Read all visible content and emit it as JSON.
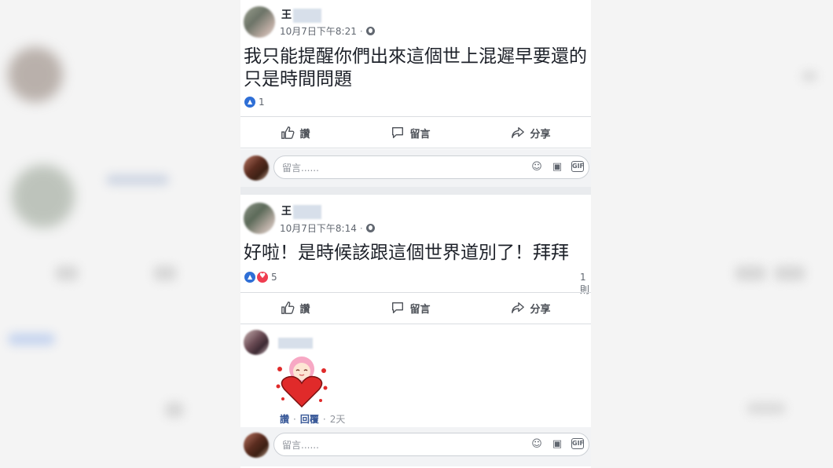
{
  "posts": [
    {
      "author": "王",
      "timestamp": "10月7日下午8:21",
      "text_line1": "我只能提醒你們出來這個世上混遲早要還的",
      "text_line2": "只是時間問題",
      "reaction_count": "1",
      "comment_count": ""
    },
    {
      "author": "王",
      "timestamp": "10月7日下午8:14",
      "text_line1": "好啦！是時候該跟這個世界道別了！拜拜",
      "reaction_count": "5",
      "comment_count": "1則"
    }
  ],
  "actions": {
    "like": "讚",
    "comment": "留言",
    "share": "分享"
  },
  "comment_box": {
    "placeholder": "留言......"
  },
  "comment": {
    "like_link": "讚",
    "reply_link": "回覆",
    "time": "2天",
    "sticker": "heart-hug-sticker"
  },
  "icons": [
    "globe-icon",
    "like-icon",
    "comment-icon",
    "share-icon",
    "emoji-icon",
    "camera-icon",
    "gif-icon",
    "like-reaction-icon",
    "love-reaction-icon"
  ],
  "colors": {
    "link": "#385898",
    "like_blue": "#2f6fd6",
    "love_red": "#ef3d50",
    "divider": "#dadde1"
  }
}
